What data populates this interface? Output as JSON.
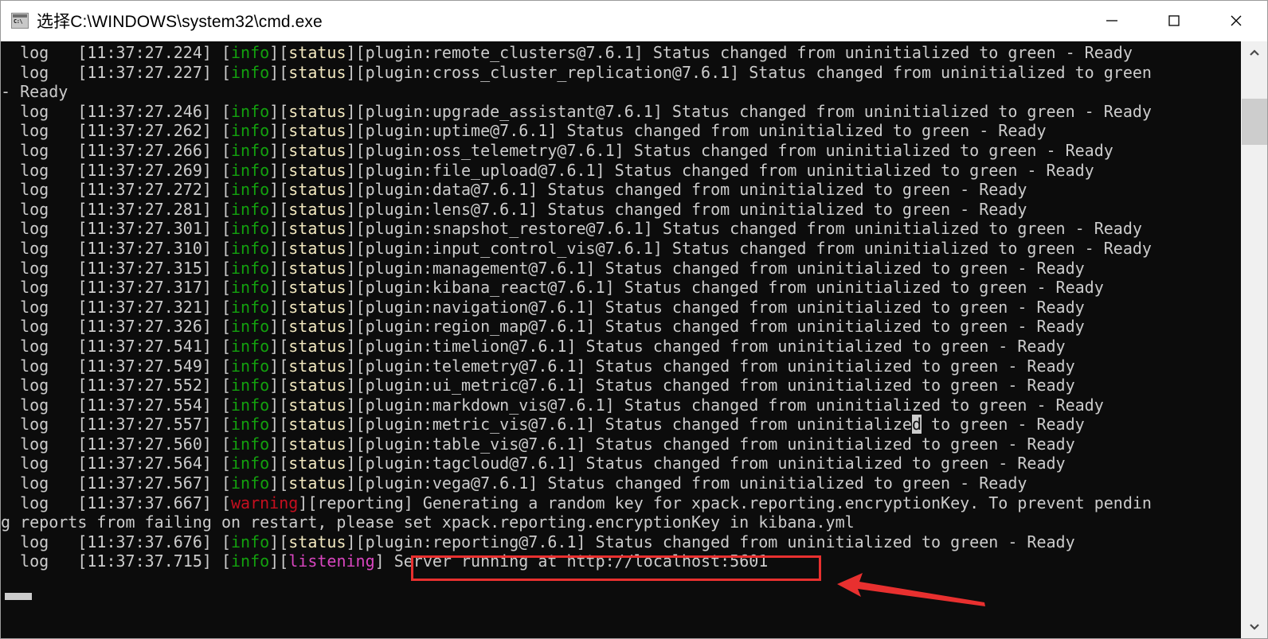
{
  "window": {
    "title": "选择C:\\WINDOWS\\system32\\cmd.exe",
    "icon": "cmd-console-icon",
    "minimize_label": "–",
    "maximize_label": "□",
    "close_label": "✕"
  },
  "console": {
    "background_color": "#0c0c0c",
    "text_color": "#cccccc",
    "colors": {
      "gray": "#cccccc",
      "green": "#13a10e",
      "yellow": "#f3e9c0",
      "red": "#c50f1f",
      "magenta": "#d946c0",
      "annotation_red": "#e8302f"
    },
    "lines": [
      {
        "id": 0,
        "type": "log",
        "prefix": "  log   ",
        "timestamp": "[11:37:27.224]",
        "level": "info",
        "tag": "status",
        "message": "[plugin:remote_clusters@7.6.1] Status changed from uninitialized to green - Ready"
      },
      {
        "id": 1,
        "type": "log",
        "prefix": "  log   ",
        "timestamp": "[11:37:27.227]",
        "level": "info",
        "tag": "status",
        "message": "[plugin:cross_cluster_replication@7.6.1] Status changed from uninitialized to green"
      },
      {
        "id": 2,
        "type": "wrap",
        "message": "- Ready"
      },
      {
        "id": 3,
        "type": "log",
        "prefix": "  log   ",
        "timestamp": "[11:37:27.246]",
        "level": "info",
        "tag": "status",
        "message": "[plugin:upgrade_assistant@7.6.1] Status changed from uninitialized to green - Ready"
      },
      {
        "id": 4,
        "type": "log",
        "prefix": "  log   ",
        "timestamp": "[11:37:27.262]",
        "level": "info",
        "tag": "status",
        "message": "[plugin:uptime@7.6.1] Status changed from uninitialized to green - Ready"
      },
      {
        "id": 5,
        "type": "log",
        "prefix": "  log   ",
        "timestamp": "[11:37:27.266]",
        "level": "info",
        "tag": "status",
        "message": "[plugin:oss_telemetry@7.6.1] Status changed from uninitialized to green - Ready"
      },
      {
        "id": 6,
        "type": "log",
        "prefix": "  log   ",
        "timestamp": "[11:37:27.269]",
        "level": "info",
        "tag": "status",
        "message": "[plugin:file_upload@7.6.1] Status changed from uninitialized to green - Ready"
      },
      {
        "id": 7,
        "type": "log",
        "prefix": "  log   ",
        "timestamp": "[11:37:27.272]",
        "level": "info",
        "tag": "status",
        "message": "[plugin:data@7.6.1] Status changed from uninitialized to green - Ready"
      },
      {
        "id": 8,
        "type": "log",
        "prefix": "  log   ",
        "timestamp": "[11:37:27.281]",
        "level": "info",
        "tag": "status",
        "message": "[plugin:lens@7.6.1] Status changed from uninitialized to green - Ready"
      },
      {
        "id": 9,
        "type": "log",
        "prefix": "  log   ",
        "timestamp": "[11:37:27.301]",
        "level": "info",
        "tag": "status",
        "message": "[plugin:snapshot_restore@7.6.1] Status changed from uninitialized to green - Ready"
      },
      {
        "id": 10,
        "type": "log",
        "prefix": "  log   ",
        "timestamp": "[11:37:27.310]",
        "level": "info",
        "tag": "status",
        "message": "[plugin:input_control_vis@7.6.1] Status changed from uninitialized to green - Ready"
      },
      {
        "id": 11,
        "type": "log",
        "prefix": "  log   ",
        "timestamp": "[11:37:27.315]",
        "level": "info",
        "tag": "status",
        "message": "[plugin:management@7.6.1] Status changed from uninitialized to green - Ready"
      },
      {
        "id": 12,
        "type": "log",
        "prefix": "  log   ",
        "timestamp": "[11:37:27.317]",
        "level": "info",
        "tag": "status",
        "message": "[plugin:kibana_react@7.6.1] Status changed from uninitialized to green - Ready"
      },
      {
        "id": 13,
        "type": "log",
        "prefix": "  log   ",
        "timestamp": "[11:37:27.321]",
        "level": "info",
        "tag": "status",
        "message": "[plugin:navigation@7.6.1] Status changed from uninitialized to green - Ready"
      },
      {
        "id": 14,
        "type": "log",
        "prefix": "  log   ",
        "timestamp": "[11:37:27.326]",
        "level": "info",
        "tag": "status",
        "message": "[plugin:region_map@7.6.1] Status changed from uninitialized to green - Ready"
      },
      {
        "id": 15,
        "type": "log",
        "prefix": "  log   ",
        "timestamp": "[11:37:27.541]",
        "level": "info",
        "tag": "status",
        "message": "[plugin:timelion@7.6.1] Status changed from uninitialized to green - Ready"
      },
      {
        "id": 16,
        "type": "log",
        "prefix": "  log   ",
        "timestamp": "[11:37:27.549]",
        "level": "info",
        "tag": "status",
        "message": "[plugin:telemetry@7.6.1] Status changed from uninitialized to green - Ready"
      },
      {
        "id": 17,
        "type": "log",
        "prefix": "  log   ",
        "timestamp": "[11:37:27.552]",
        "level": "info",
        "tag": "status",
        "message": "[plugin:ui_metric@7.6.1] Status changed from uninitialized to green - Ready"
      },
      {
        "id": 18,
        "type": "log",
        "prefix": "  log   ",
        "timestamp": "[11:37:27.554]",
        "level": "info",
        "tag": "status",
        "message": "[plugin:markdown_vis@7.6.1] Status changed from uninitialized to green - Ready"
      },
      {
        "id": 19,
        "type": "log-cursor",
        "prefix": "  log   ",
        "timestamp": "[11:37:27.557]",
        "level": "info",
        "tag": "status",
        "message_before": "[plugin:metric_vis@7.6.1] Status changed from uninitialize",
        "cursor_char": "d",
        "message_after": " to green - Ready"
      },
      {
        "id": 20,
        "type": "log",
        "prefix": "  log   ",
        "timestamp": "[11:37:27.560]",
        "level": "info",
        "tag": "status",
        "message": "[plugin:table_vis@7.6.1] Status changed from uninitialized to green - Ready"
      },
      {
        "id": 21,
        "type": "log",
        "prefix": "  log   ",
        "timestamp": "[11:37:27.564]",
        "level": "info",
        "tag": "status",
        "message": "[plugin:tagcloud@7.6.1] Status changed from uninitialized to green - Ready"
      },
      {
        "id": 22,
        "type": "log",
        "prefix": "  log   ",
        "timestamp": "[11:37:27.567]",
        "level": "info",
        "tag": "status",
        "message": "[plugin:vega@7.6.1] Status changed from uninitialized to green - Ready"
      },
      {
        "id": 23,
        "type": "warning",
        "prefix": "  log   ",
        "timestamp": "[11:37:37.667]",
        "level": "warning",
        "tag": "reporting",
        "message": " Generating a random key for xpack.reporting.encryptionKey. To prevent pendin"
      },
      {
        "id": 24,
        "type": "wrap",
        "message": "g reports from failing on restart, please set xpack.reporting.encryptionKey in kibana.yml"
      },
      {
        "id": 25,
        "type": "log",
        "prefix": "  log   ",
        "timestamp": "[11:37:37.676]",
        "level": "info",
        "tag": "status",
        "message": "[plugin:reporting@7.6.1] Status changed from uninitialized to green - Ready"
      },
      {
        "id": 26,
        "type": "listening",
        "prefix": "  log   ",
        "timestamp": "[11:37:37.715]",
        "level": "info",
        "tag": "listening",
        "message": " Server running at http://localhost:5601"
      }
    ],
    "cursor": {
      "visible": true,
      "shape": "block"
    }
  },
  "annotations": {
    "highlight_box": {
      "label": "server-url-highlight",
      "text": "Server running at http://localhost:5601",
      "color": "#e8302f"
    },
    "arrow": {
      "label": "pointer-arrow",
      "direction": "left",
      "color": "#e8302f"
    }
  },
  "scrollbar": {
    "up_label": "scroll-up",
    "down_label": "scroll-down",
    "thumb_label": "scroll-thumb"
  }
}
